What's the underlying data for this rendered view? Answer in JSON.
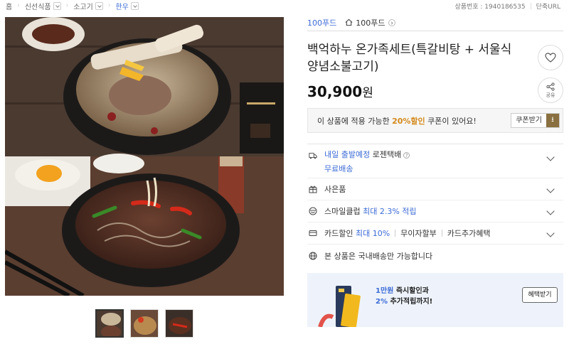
{
  "breadcrumb": {
    "home": "홈",
    "items": [
      "신선식품",
      "소고기",
      "한우"
    ]
  },
  "top_right": {
    "product_no_label": "상품번호 : 1940186535",
    "short_url": "단축URL"
  },
  "seller": {
    "link": "100푸드",
    "shop_name": "100푸드"
  },
  "product": {
    "title": "백억하누 온가족세트(특갈비탕 + 서울식양념소불고기)",
    "price": "30,900",
    "price_unit": "원"
  },
  "actions": {
    "share_label": "공유"
  },
  "coupon": {
    "text_before": "이 상품에 적용 가능한",
    "highlight": "20%할인",
    "text_after": "쿠폰이 있어요!",
    "button": "쿠폰받기"
  },
  "shipping": {
    "date": "내일 출발예정",
    "carrier": "로젠택배",
    "help": "?",
    "free": "무료배송"
  },
  "gift": {
    "label": "사은품"
  },
  "smileclub": {
    "text": "스마일클럽",
    "highlight": "최대 2.3% 적립"
  },
  "card": {
    "label": "카드할인",
    "highlight": "최대 10%",
    "installment": "무이자할부",
    "extra": "카드추가혜택"
  },
  "domestic": {
    "text": "본 상품은 국내배송만 가능합니다"
  },
  "banner": {
    "line1_hl": "1만원",
    "line1": "즉시할인과",
    "line2_hl": "2%",
    "line2": "추가적립까지!",
    "button": "혜택받기"
  },
  "colors": {
    "accent_blue": "#3c6bd6",
    "coupon_orange": "#d4891c",
    "banner_bg": "#eef3fb"
  }
}
